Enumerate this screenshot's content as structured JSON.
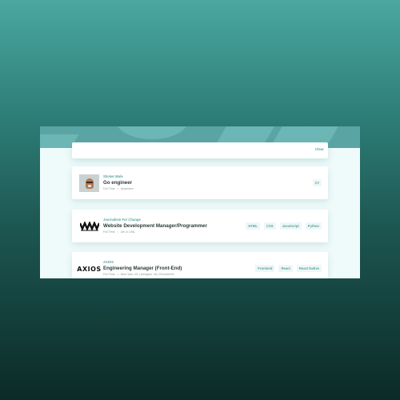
{
  "filter_bar": {
    "clear_label": "Clear"
  },
  "jobs": [
    {
      "company": "Sticker Mule",
      "position": "Go engineer",
      "contract": "Full Time",
      "location": "Anywhere",
      "logo_icon": "photo-avatar",
      "tags": [
        "C#"
      ]
    },
    {
      "company": "Journalism For Change",
      "position": "Website Development Manager/Programmer",
      "contract": "Full Time",
      "location": "UK or USA",
      "logo_icon": "wave-logo",
      "tags": [
        "HTML",
        "CSS",
        "JavaScript",
        "Python"
      ]
    },
    {
      "company": "AXIOS",
      "position": "Engineering Manager (Front-End)",
      "contract": "Full Time",
      "location": "New York, NY | Arlington, VA | Remote/US",
      "logo_text": "AXIOS",
      "logo_icon": "axios-logo",
      "tags": [
        "Frontend",
        "React",
        "React Native"
      ]
    }
  ],
  "colors": {
    "accent": "#5ba4a4",
    "window_bg": "#effafa",
    "title": "#2c3a3a"
  }
}
